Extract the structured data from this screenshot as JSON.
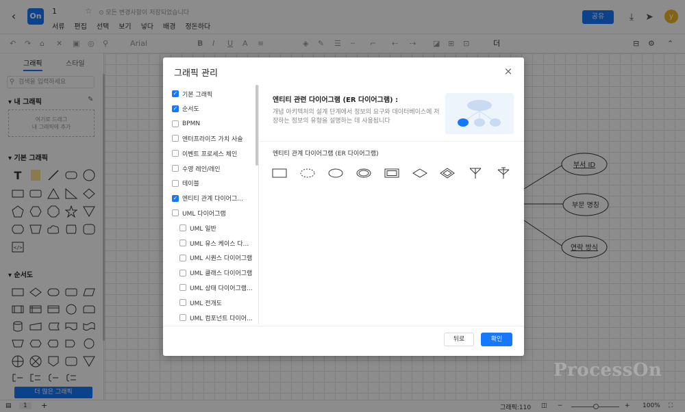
{
  "header": {
    "back_icon": "chevron-left-icon",
    "logo_text": "On",
    "doc_title": "1",
    "star_icon": "star-icon",
    "saved_text": "모든 변경사항이 저장되었습니다",
    "menus": [
      "서류",
      "편집",
      "선택",
      "보기",
      "넣다",
      "배경",
      "정돈하다"
    ],
    "share_label": "공유",
    "avatar_text": "y",
    "accent_color": "#1677ff"
  },
  "toolbar": {
    "font_name": "Arial",
    "more_label": "더"
  },
  "left_panel": {
    "tabs": [
      "그래픽",
      "스타일"
    ],
    "search_placeholder": "검색을 입력하세요",
    "my_graphics_title": "내 그래픽",
    "drop_hint_line1": "여기로 드래그",
    "drop_hint_line2": "내 그래픽에 추가",
    "basic_title": "기본 그래픽",
    "flow_title": "순서도",
    "more_button": "더 많은 그래픽"
  },
  "canvas": {
    "entities": [
      "부서 ID",
      "부문 명칭",
      "연락 방식"
    ]
  },
  "status": {
    "page_number": "1",
    "add": "+",
    "graphics_count": "그래픽:110",
    "zoom": "100%"
  },
  "modal": {
    "title": "그래픽 관리",
    "categories": [
      {
        "label": "기본 그래픽",
        "checked": true,
        "indent": false
      },
      {
        "label": "순서도",
        "checked": true,
        "indent": false
      },
      {
        "label": "BPMN",
        "checked": false,
        "indent": false
      },
      {
        "label": "엔터프라이즈 가치 사슬",
        "checked": false,
        "indent": false
      },
      {
        "label": "이벤트 프로세스 체인",
        "checked": false,
        "indent": false
      },
      {
        "label": "수영 레인/레인",
        "checked": false,
        "indent": false
      },
      {
        "label": "테이블",
        "checked": false,
        "indent": false
      },
      {
        "label": "엔티티 관계 다이어그...",
        "checked": true,
        "indent": false
      },
      {
        "label": "UML 다이어그램",
        "checked": false,
        "indent": false
      },
      {
        "label": "UML 일반",
        "checked": false,
        "indent": true
      },
      {
        "label": "UML 유스 케이스 다...",
        "checked": false,
        "indent": true
      },
      {
        "label": "UML 시퀀스 다이어그램",
        "checked": false,
        "indent": true
      },
      {
        "label": "UML 클래스 다이어그램",
        "checked": false,
        "indent": true
      },
      {
        "label": "UML 상태 다이어그램...",
        "checked": false,
        "indent": true
      },
      {
        "label": "UML 전개도",
        "checked": false,
        "indent": true
      },
      {
        "label": "UML 컴포넌트 다이어...",
        "checked": false,
        "indent": true
      }
    ],
    "detail_title": "엔티티 관련 다이어그램 (ER 다이어그램) :",
    "detail_desc": "개념 아키텍처의 설계 단계에서 정보의 요구와 데이터베이스에 저장하는 정보의 유형을 설명하는 데 사용됩니다",
    "subsection_title": "엔티티 관계 다이어그램 (ER 다이어그램)",
    "er_shapes": [
      "entity-icon",
      "weak-attribute-icon",
      "attribute-icon",
      "multivalued-attribute-icon",
      "weak-entity-icon",
      "relationship-icon",
      "identifying-relationship-icon",
      "one-to-many-icon",
      "many-to-many-icon"
    ],
    "back_label": "뒤로",
    "ok_label": "확인"
  },
  "watermark": "ProcessOn"
}
